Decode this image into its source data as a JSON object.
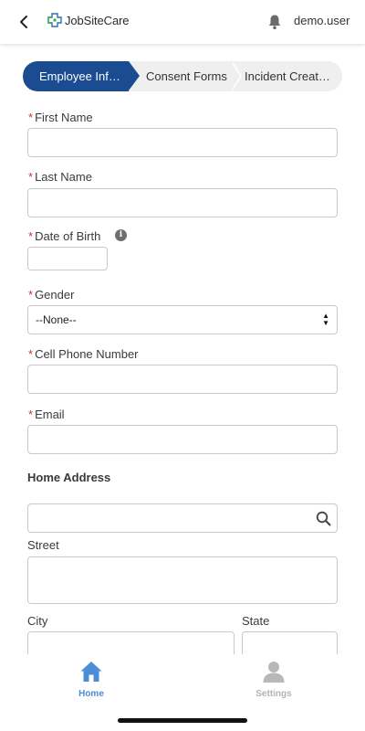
{
  "header": {
    "back_icon": "chevron-left-icon",
    "brand_name": "JobSiteCare",
    "brand_logo": "medical-cross-logo",
    "notification_icon": "bell-icon",
    "user_name": "demo.user"
  },
  "path": {
    "steps": [
      {
        "label": "Employee Inf…",
        "state": "active"
      },
      {
        "label": "Consent Forms",
        "state": "inactive"
      },
      {
        "label": "Incident Creat…",
        "state": "inactive"
      }
    ],
    "active_color": "#1b4b91"
  },
  "form": {
    "required_marker": "*",
    "first_name": {
      "label": "First Name",
      "value": ""
    },
    "last_name": {
      "label": "Last Name",
      "value": ""
    },
    "date_of_birth": {
      "label": "Date of Birth",
      "value": "",
      "info_icon": "info-icon"
    },
    "gender": {
      "label": "Gender",
      "selected": "--None--"
    },
    "cell_phone": {
      "label": "Cell Phone Number",
      "value": ""
    },
    "email": {
      "label": "Email",
      "value": ""
    },
    "home_address": {
      "title": "Home Address",
      "search_value": "",
      "street_label": "Street",
      "city_label": "City",
      "state_label": "State"
    }
  },
  "tabbar": {
    "home_label": "Home",
    "settings_label": "Settings",
    "home_color": "#4a8fd6",
    "settings_color": "#b3b3b3"
  }
}
